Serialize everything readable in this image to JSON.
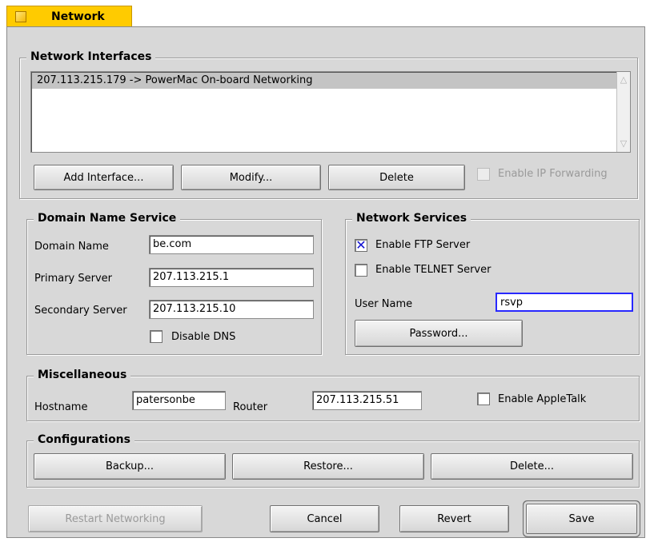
{
  "window": {
    "title": "Network"
  },
  "interfaces": {
    "legend": "Network Interfaces",
    "items": [
      "207.113.215.179 -> PowerMac On-board Networking"
    ],
    "add_label": "Add Interface...",
    "modify_label": "Modify...",
    "delete_label": "Delete",
    "ip_forwarding_label": "Enable IP Forwarding",
    "ip_forwarding_checked": false
  },
  "dns": {
    "legend": "Domain Name Service",
    "domain_name_label": "Domain Name",
    "domain_name_value": "be.com",
    "primary_label": "Primary Server",
    "primary_value": "207.113.215.1",
    "secondary_label": "Secondary Server",
    "secondary_value": "207.113.215.10",
    "disable_dns_label": "Disable DNS",
    "disable_dns_checked": false
  },
  "services": {
    "legend": "Network Services",
    "ftp_label": "Enable FTP Server",
    "ftp_checked": true,
    "telnet_label": "Enable TELNET Server",
    "telnet_checked": false,
    "username_label": "User Name",
    "username_value": "rsvp",
    "password_label": "Password..."
  },
  "misc": {
    "legend": "Miscellaneous",
    "hostname_label": "Hostname",
    "hostname_value": "patersonbe",
    "router_label": "Router",
    "router_value": "207.113.215.51",
    "appletalk_label": "Enable AppleTalk",
    "appletalk_checked": false
  },
  "configs": {
    "legend": "Configurations",
    "backup_label": "Backup...",
    "restore_label": "Restore...",
    "delete_label": "Delete..."
  },
  "footer": {
    "restart_label": "Restart Networking",
    "cancel_label": "Cancel",
    "revert_label": "Revert",
    "save_label": "Save"
  },
  "colors": {
    "tab": "#ffcb00",
    "focus": "#2828ff",
    "check": "#1010d0"
  }
}
